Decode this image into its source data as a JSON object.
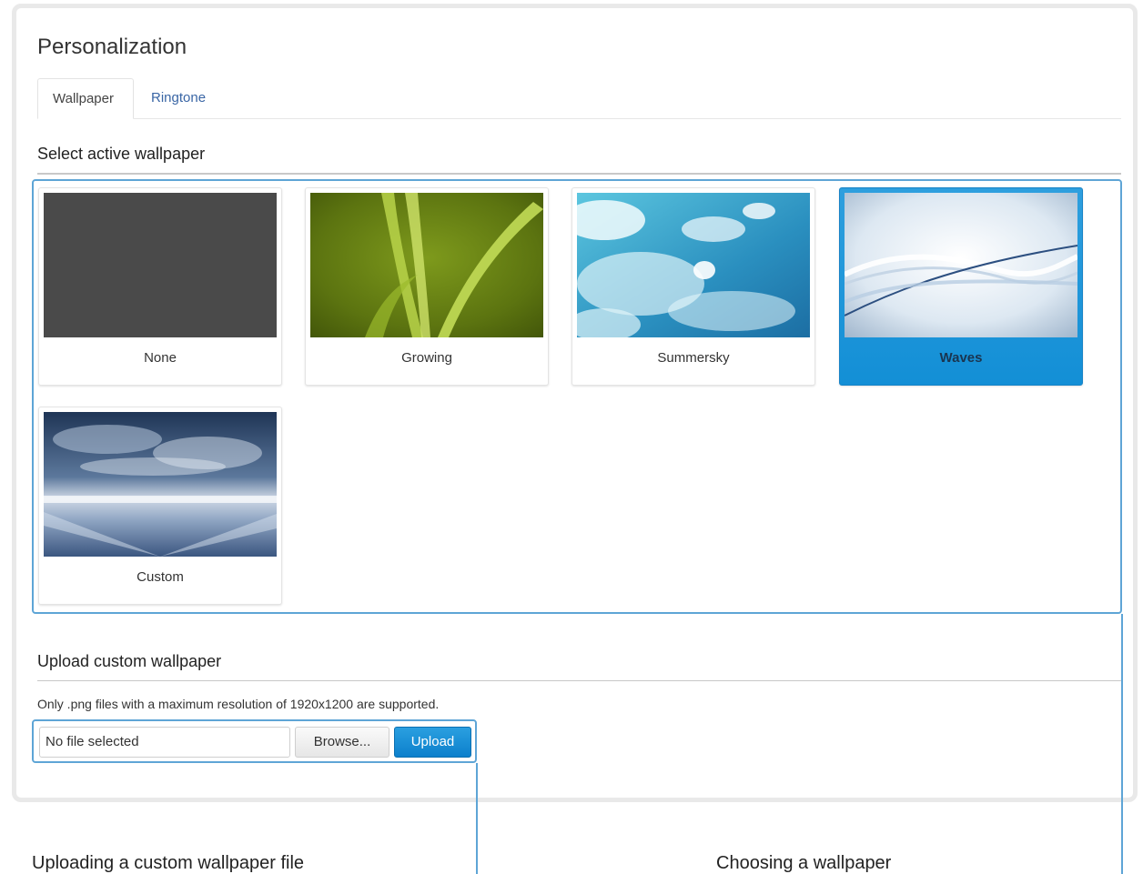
{
  "page": {
    "title": "Personalization"
  },
  "tabs": [
    {
      "label": "Wallpaper",
      "active": true
    },
    {
      "label": "Ringtone",
      "active": false
    }
  ],
  "wallpaper_section": {
    "heading": "Select active wallpaper",
    "items": [
      {
        "label": "None",
        "selected": false
      },
      {
        "label": "Growing",
        "selected": false
      },
      {
        "label": "Summersky",
        "selected": false
      },
      {
        "label": "Waves",
        "selected": true
      },
      {
        "label": "Custom",
        "selected": false
      }
    ]
  },
  "upload_section": {
    "heading": "Upload custom wallpaper",
    "hint": "Only .png files with a maximum resolution of 1920x1200 are supported.",
    "file_value": "No file selected",
    "browse_label": "Browse...",
    "upload_label": "Upload"
  },
  "callouts": {
    "upload": "Uploading a custom wallpaper file",
    "choose": "Choosing a wallpaper"
  },
  "colors": {
    "accent": "#138fd6",
    "callout_border": "#5ea5d6",
    "link": "#3a66a5",
    "none_wallpaper": "#4a4a4a"
  }
}
